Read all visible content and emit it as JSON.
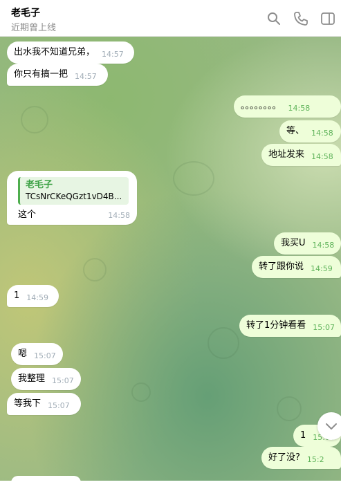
{
  "header": {
    "title": "老毛子",
    "status": "近期曾上线",
    "icons": [
      "search-icon",
      "phone-icon",
      "sidebar-toggle-icon"
    ]
  },
  "messages": [
    {
      "dir": "in",
      "text": "出水我不知道兄弟，",
      "time": "14:57"
    },
    {
      "dir": "in",
      "text": "你只有搞一把",
      "time": "14:57"
    },
    {
      "dir": "out",
      "text": "。。。。。。。。",
      "time": "14:58"
    },
    {
      "dir": "out",
      "text": "等、",
      "time": "14:58"
    },
    {
      "dir": "out",
      "text": "地址发来",
      "time": "14:58"
    },
    {
      "dir": "out",
      "text": "我买U",
      "time": "14:58"
    },
    {
      "dir": "out",
      "text": "转了跟你说",
      "time": "14:59"
    },
    {
      "dir": "in",
      "text": "1",
      "time": "14:59"
    },
    {
      "dir": "out",
      "text": "转了1分钟看看",
      "time": "15:07"
    },
    {
      "dir": "in",
      "text": "嗯",
      "time": "15:07"
    },
    {
      "dir": "in",
      "text": "我整理",
      "time": "15:07"
    },
    {
      "dir": "in",
      "text": "等我下",
      "time": "15:07"
    },
    {
      "dir": "out",
      "text": "1",
      "time": "15:08"
    },
    {
      "dir": "out",
      "text": "好了没?",
      "time": "15:2"
    }
  ],
  "reply_message": {
    "quoted_name": "老毛子",
    "quoted_text": "TCsNrCKeQGzt1vD4B...",
    "text": "这个",
    "time": "14:58"
  },
  "colors": {
    "incoming_bubble": "#ffffff",
    "outgoing_bubble": "#eefed9",
    "outgoing_time": "#5fb35a",
    "quote_accent": "#4fae4e"
  }
}
